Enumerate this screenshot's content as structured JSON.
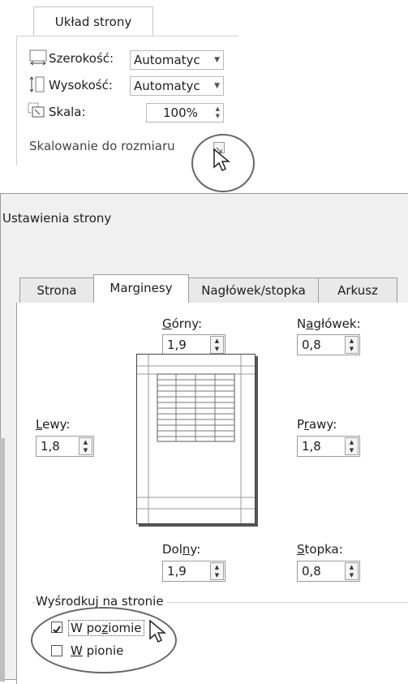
{
  "ribbon": {
    "tab_label": "Układ strony",
    "width": {
      "label": "Szerokość:",
      "value": "Automatyc"
    },
    "height": {
      "label": "Wysokość:",
      "value": "Automatyc"
    },
    "scale": {
      "label": "Skala:",
      "value": "100%"
    },
    "group_caption": "Skalowanie do rozmiaru"
  },
  "dialog": {
    "title": "Ustawienia strony",
    "tabs": [
      "Strona",
      "Marginesy",
      "Nagłówek/stopka",
      "Arkusz"
    ],
    "active_tab": "Marginesy",
    "margins": {
      "top": {
        "label_pre": "",
        "label_u": "G",
        "label_post": "órny:",
        "value": "1,9"
      },
      "header": {
        "label_pre": "N",
        "label_u": "a",
        "label_post": "główek:",
        "value": "0,8"
      },
      "left": {
        "label_pre": "",
        "label_u": "L",
        "label_post": "ewy:",
        "value": "1,8"
      },
      "right": {
        "label_pre": "P",
        "label_u": "r",
        "label_post": "awy:",
        "value": "1,8"
      },
      "bottom": {
        "label_pre": "Dol",
        "label_u": "n",
        "label_post": "y:",
        "value": "1,9"
      },
      "footer": {
        "label_pre": "",
        "label_u": "S",
        "label_post": "topka:",
        "value": "0,8"
      }
    },
    "center": {
      "group_title": "Wyśrodkuj na stronie",
      "horizontal": {
        "label_pre": "W po",
        "label_u": "z",
        "label_post": "iomie",
        "checked": true
      },
      "vertical": {
        "label_pre": "",
        "label_u": "W",
        "label_post": " pionie",
        "checked": false
      }
    }
  }
}
